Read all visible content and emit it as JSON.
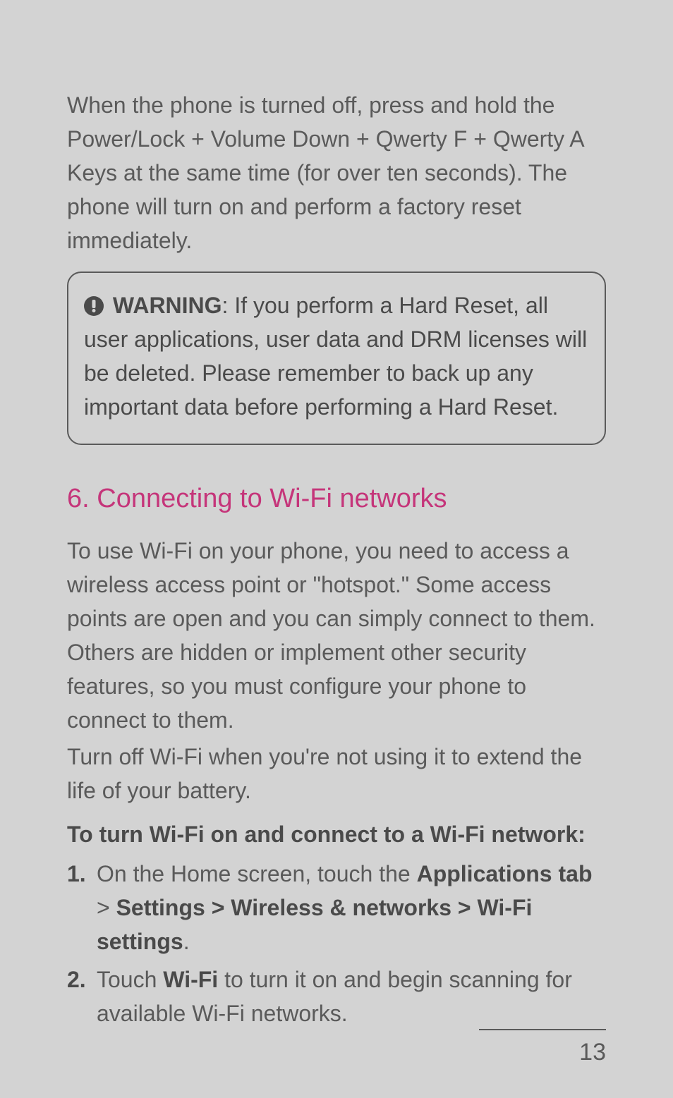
{
  "intro": "When the phone is turned off, press and hold the Power/Lock + Volume Down + Qwerty F + Qwerty A Keys at the same time (for over ten seconds). The phone will turn on and perform a factory reset immediately.",
  "warning": {
    "label": "WARNING",
    "text": ": If you perform a Hard Reset, all user applications, user data and DRM licenses will be deleted. Please remember to back up any important data before performing a Hard Reset."
  },
  "section": {
    "heading": "6. Connecting to Wi-Fi networks",
    "paragraph1": "To use Wi-Fi on your phone, you need to access a wireless access point or \"hotspot.\" Some access points are open and you can simply connect to them. Others are hidden or implement other security features, so you must configure your phone to connect to them.",
    "paragraph2": "Turn off Wi-Fi when you're not using it to extend the life of your battery.",
    "subheading": "To turn Wi-Fi on and connect to a Wi-Fi network:",
    "steps": [
      {
        "num": "1.",
        "prefix": "On the Home screen, touch the ",
        "bold1": "Applications tab",
        "mid": " > ",
        "bold2": "Settings > Wireless & networks > Wi-Fi settings",
        "suffix": "."
      },
      {
        "num": "2.",
        "prefix": "Touch ",
        "bold1": "Wi-Fi",
        "mid": " to turn it on and begin scanning for available Wi-Fi networks.",
        "bold2": "",
        "suffix": ""
      }
    ]
  },
  "pageNumber": "13"
}
